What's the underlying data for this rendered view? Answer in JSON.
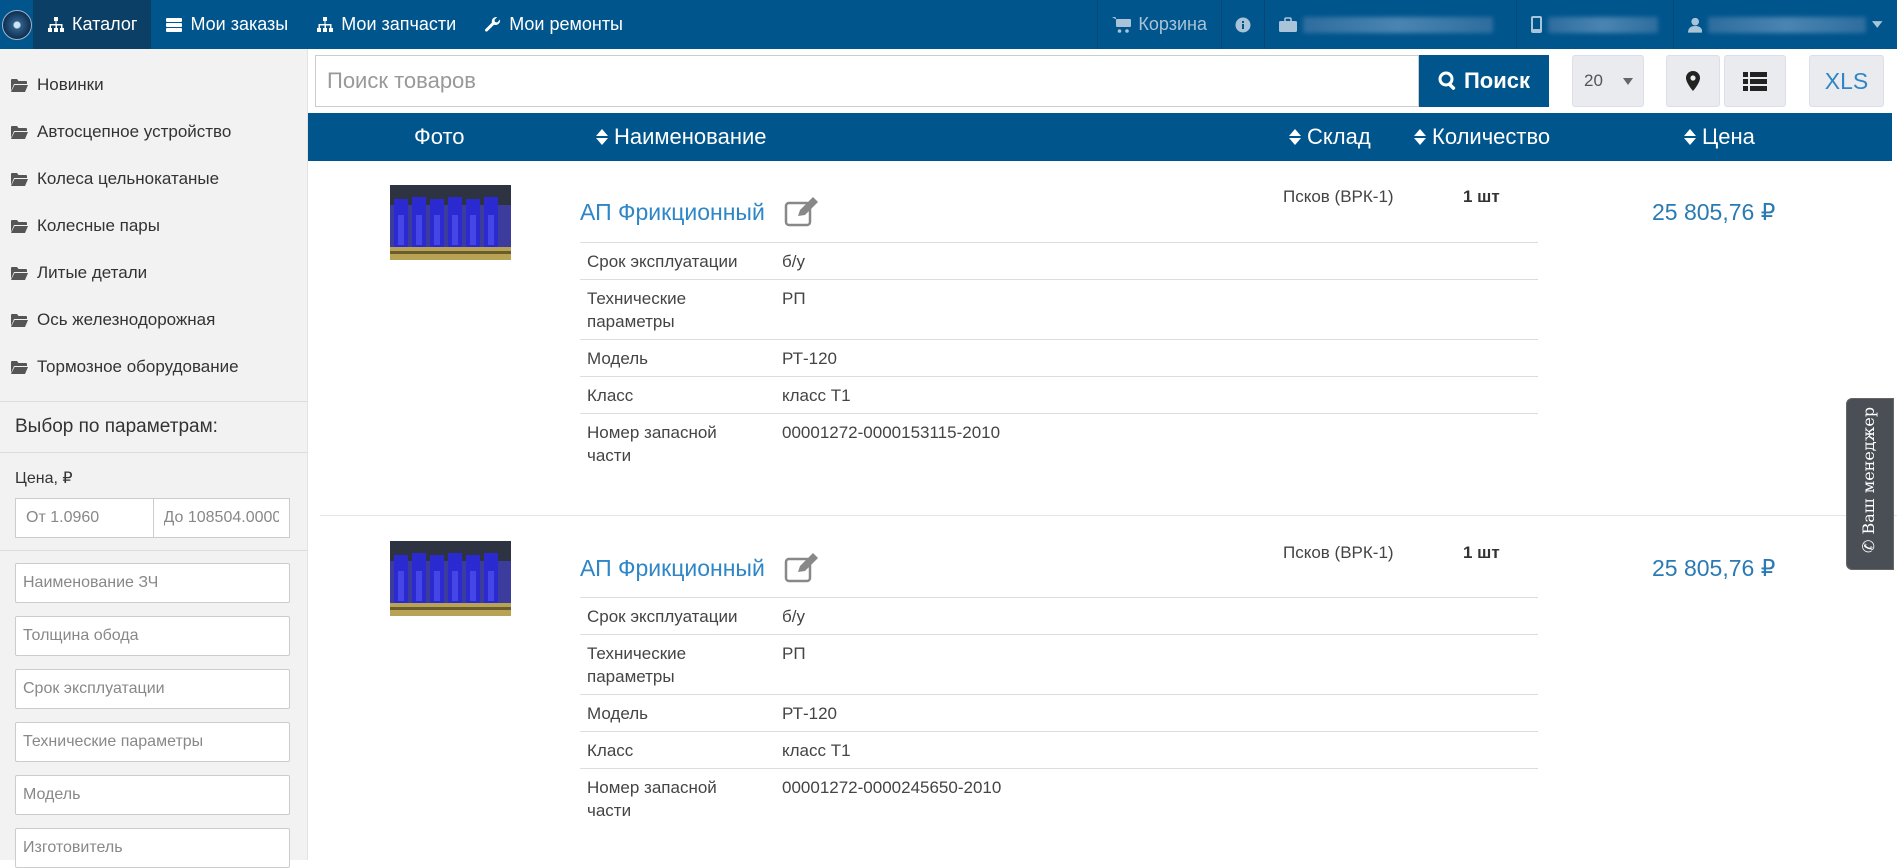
{
  "nav": {
    "items": [
      {
        "label": "Каталог",
        "icon": "sitemap-icon",
        "active": true
      },
      {
        "label": "Мои заказы",
        "icon": "list-icon"
      },
      {
        "label": "Мои запчасти",
        "icon": "sitemap-icon"
      },
      {
        "label": "Мои ремонты",
        "icon": "wrench-icon"
      }
    ],
    "cart_label": "Корзина",
    "info_icon": "info-icon",
    "company_icon": "briefcase-icon",
    "phone_icon": "mobile-icon",
    "user_icon": "user-icon"
  },
  "sidebar": {
    "categories": [
      "Новинки",
      "Автосцепное устройство",
      "Колеса цельнокатаные",
      "Колесные пары",
      "Литые детали",
      "Ось железнодорожная",
      "Тормозное оборудование"
    ],
    "params_title": "Выбор по параметрам:",
    "price_label": "Цена, ₽",
    "price_from_placeholder": "От 1.0960",
    "price_to_placeholder": "До 108504.0000",
    "filters": [
      "Наименование ЗЧ",
      "Толщина обода",
      "Срок эксплуатации",
      "Технические параметры",
      "Модель",
      "Изготовитель"
    ]
  },
  "search": {
    "placeholder": "Поиск товаров",
    "button_label": "Поиск",
    "page_size": "20",
    "xls_label": "XLS"
  },
  "table": {
    "headers": {
      "photo": "Фото",
      "name": "Наименование",
      "stock": "Склад",
      "qty": "Количество",
      "price": "Цена"
    }
  },
  "products": [
    {
      "name": "АП Фрикционный",
      "stock": "Псков (ВРК-1)",
      "qty": "1 шт",
      "price": "25 805,76 ₽",
      "specs": [
        {
          "k": "Срок эксплуатации",
          "v": "б/у"
        },
        {
          "k": "Технические параметры",
          "v": "РП"
        },
        {
          "k": "Модель",
          "v": "РТ-120"
        },
        {
          "k": "Класс",
          "v": "класс Т1"
        },
        {
          "k": "Номер запасной части",
          "v": "00001272-0000153115-2010"
        }
      ]
    },
    {
      "name": "АП Фрикционный",
      "stock": "Псков (ВРК-1)",
      "qty": "1 шт",
      "price": "25 805,76 ₽",
      "specs": [
        {
          "k": "Срок эксплуатации",
          "v": "б/у"
        },
        {
          "k": "Технические параметры",
          "v": "РП"
        },
        {
          "k": "Модель",
          "v": "РТ-120"
        },
        {
          "k": "Класс",
          "v": "класс Т1"
        },
        {
          "k": "Номер запасной части",
          "v": "00001272-0000245650-2010"
        }
      ]
    }
  ],
  "manager_tab": "Ваш менеджер",
  "colors": {
    "primary": "#00558d",
    "link": "#2f86c6",
    "sidebar_bg": "#f2f2f2"
  }
}
